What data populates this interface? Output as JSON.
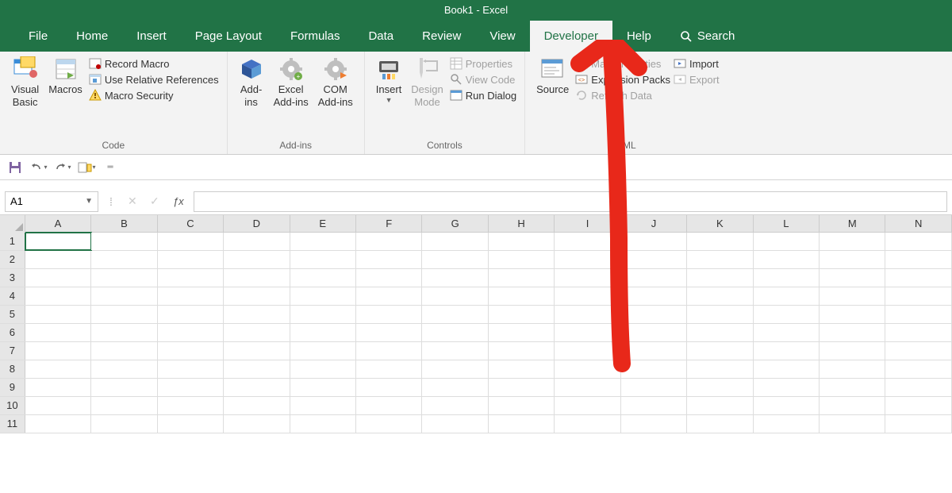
{
  "title": "Book1 - Excel",
  "tabs": {
    "file": "File",
    "home": "Home",
    "insert": "Insert",
    "pagelayout": "Page Layout",
    "formulas": "Formulas",
    "data": "Data",
    "review": "Review",
    "view": "View",
    "developer": "Developer",
    "help": "Help",
    "search": "Search"
  },
  "ribbon": {
    "code": {
      "label": "Code",
      "visual_basic": "Visual\nBasic",
      "macros": "Macros",
      "record_macro": "Record Macro",
      "use_relative": "Use Relative References",
      "macro_security": "Macro Security"
    },
    "addins": {
      "label": "Add-ins",
      "addins": "Add-\nins",
      "excel_addins": "Excel\nAdd-ins",
      "com_addins": "COM\nAdd-ins"
    },
    "controls": {
      "label": "Controls",
      "insert": "Insert",
      "design_mode": "Design\nMode",
      "properties": "Properties",
      "view_code": "View Code",
      "run_dialog": "Run Dialog"
    },
    "xml": {
      "label": "XML",
      "source": "Source",
      "map_properties": "Map Properties",
      "expansion_packs": "Expansion Packs",
      "refresh_data": "Refresh Data",
      "import": "Import",
      "export": "Export"
    }
  },
  "namebox": "A1",
  "columns": [
    "A",
    "B",
    "C",
    "D",
    "E",
    "F",
    "G",
    "H",
    "I",
    "J",
    "K",
    "L",
    "M",
    "N"
  ],
  "rows": [
    "1",
    "2",
    "3",
    "4",
    "5",
    "6",
    "7",
    "8",
    "9",
    "10",
    "11"
  ]
}
